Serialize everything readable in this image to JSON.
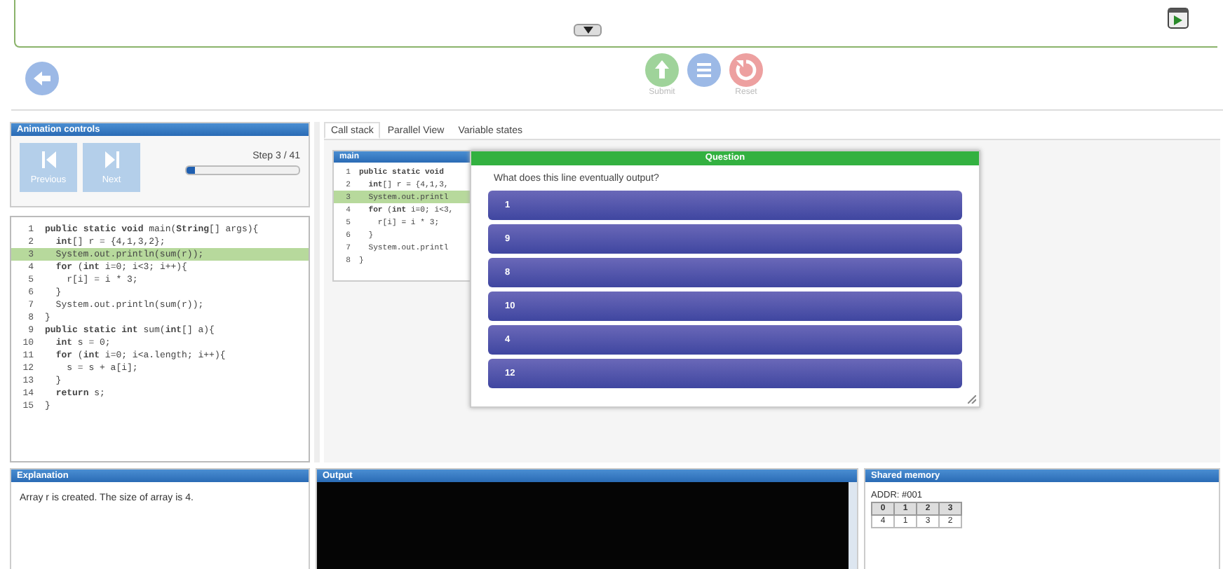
{
  "toolbar": {
    "actions": [
      {
        "kind": "submit",
        "label": "Submit"
      },
      {
        "kind": "list"
      },
      {
        "kind": "reset",
        "label": "Reset"
      }
    ]
  },
  "animation_controls": {
    "title": "Animation controls",
    "buttons": [
      {
        "kind": "previous",
        "label": "Previous"
      },
      {
        "kind": "next",
        "label": "Next"
      }
    ],
    "step": "Step 3 / 41",
    "level": 0.08
  },
  "source": {
    "lines": [
      {
        "number": "1",
        "code": "**public** **static** **void** main(**String**[] args){",
        "selected": false
      },
      {
        "number": "2",
        "code": "  **int**[] r = {4,1,3,2};",
        "selected": false
      },
      {
        "number": "3",
        "code": "  System.out.println(sum(r));",
        "selected": true
      },
      {
        "number": "4",
        "code": "  **for** (**int** i=0; i<3; i++){",
        "selected": false
      },
      {
        "number": "5",
        "code": "    r[i] = i * 3;",
        "selected": false
      },
      {
        "number": "6",
        "code": "  }",
        "selected": false
      },
      {
        "number": "7",
        "code": "  System.out.println(sum(r));",
        "selected": false
      },
      {
        "number": "8",
        "code": "}",
        "selected": false
      },
      {
        "number": "9",
        "code": "**public** **static** **int** sum(**int**[] a){",
        "selected": false
      },
      {
        "number": "10",
        "code": "  **int** s = 0;",
        "selected": false
      },
      {
        "number": "11",
        "code": "  **for** (**int** i=0; i<a.length; i++){",
        "selected": false
      },
      {
        "number": "12",
        "code": "    s = s + a[i];",
        "selected": false
      },
      {
        "number": "13",
        "code": "  }",
        "selected": false
      },
      {
        "number": "14",
        "code": "  **return** s;",
        "selected": false
      },
      {
        "number": "15",
        "code": "}",
        "selected": false
      }
    ]
  },
  "tabs": [
    {
      "label": "Call stack",
      "selected": true
    },
    {
      "label": "Parallel View",
      "selected": false
    },
    {
      "label": "Variable states",
      "selected": false
    }
  ],
  "call_stack": {
    "frames": [
      {
        "title": "main",
        "lines": [
          {
            "number": "1",
            "code": "**public** **static** **void**",
            "selected": false
          },
          {
            "number": "2",
            "code": "  **int**[] r = {4,1,3,",
            "selected": false
          },
          {
            "number": "3",
            "code": "  System.out.printl",
            "selected": true
          },
          {
            "number": "4",
            "code": "  **for** (**int** i=0; i<3,",
            "selected": false
          },
          {
            "number": "5",
            "code": "    r[i] = i * 3;",
            "selected": false
          },
          {
            "number": "6",
            "code": "  }",
            "selected": false
          },
          {
            "number": "7",
            "code": "  System.out.printl",
            "selected": false
          },
          {
            "number": "8",
            "code": "}",
            "selected": false
          }
        ]
      }
    ]
  },
  "dialog": {
    "title": "Question",
    "prompt": "What does this line eventually output?",
    "options": [
      "1",
      "9",
      "8",
      "10",
      "4",
      "12"
    ]
  },
  "explanation": {
    "title": "Explanation",
    "text": "Array r is created. The size of array is 4."
  },
  "output": {
    "title": "Output"
  },
  "shared_memory": {
    "title": "Shared memory",
    "address": "ADDR: #001",
    "headers": [
      "0",
      "1",
      "2",
      "3"
    ],
    "values": [
      "4",
      "1",
      "3",
      "2"
    ]
  }
}
